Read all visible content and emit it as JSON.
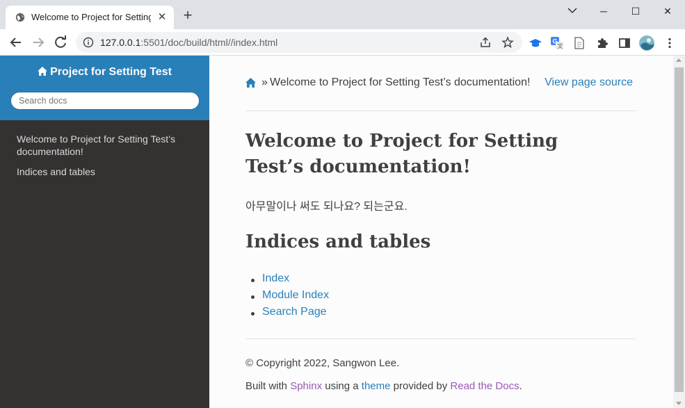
{
  "browser": {
    "tab_title": "Welcome to Project for Setting Test’s documentation!",
    "new_tab_label": "+",
    "url_host": "127.0.0.1",
    "url_rest": ":5501/doc/build/html//index.html",
    "window_controls": {
      "minimize": "─",
      "maximize": "☐",
      "close": "✕"
    }
  },
  "sidebar": {
    "brand": "Project for Setting Test",
    "search_placeholder": "Search docs",
    "items": [
      {
        "label": "Welcome to Project for Setting Test’s documentation!"
      },
      {
        "label": "Indices and tables"
      }
    ]
  },
  "breadcrumb": {
    "separator": "»",
    "current": "Welcome to Project for Setting Test’s documentation!",
    "view_source": "View page source"
  },
  "main": {
    "title": "Welcome to Project for Setting Test’s documentation!",
    "paragraph": "아무말이나 써도 되나요? 되는군요.",
    "section_title": "Indices and tables",
    "links": [
      {
        "label": "Index"
      },
      {
        "label": "Module Index"
      },
      {
        "label": "Search Page"
      }
    ]
  },
  "footer": {
    "copyright": "© Copyright 2022, Sangwon Lee.",
    "built_prefix": "Built with ",
    "sphinx": "Sphinx",
    "using_a": " using a ",
    "theme": "theme",
    "provided_by": " provided by ",
    "rtd": "Read the Docs",
    "period": "."
  },
  "colors": {
    "sidebar_bg": "#343131",
    "sidebar_header": "#2980b9",
    "link": "#2980b9",
    "visited_link": "#9b59b6",
    "text": "#404040"
  }
}
